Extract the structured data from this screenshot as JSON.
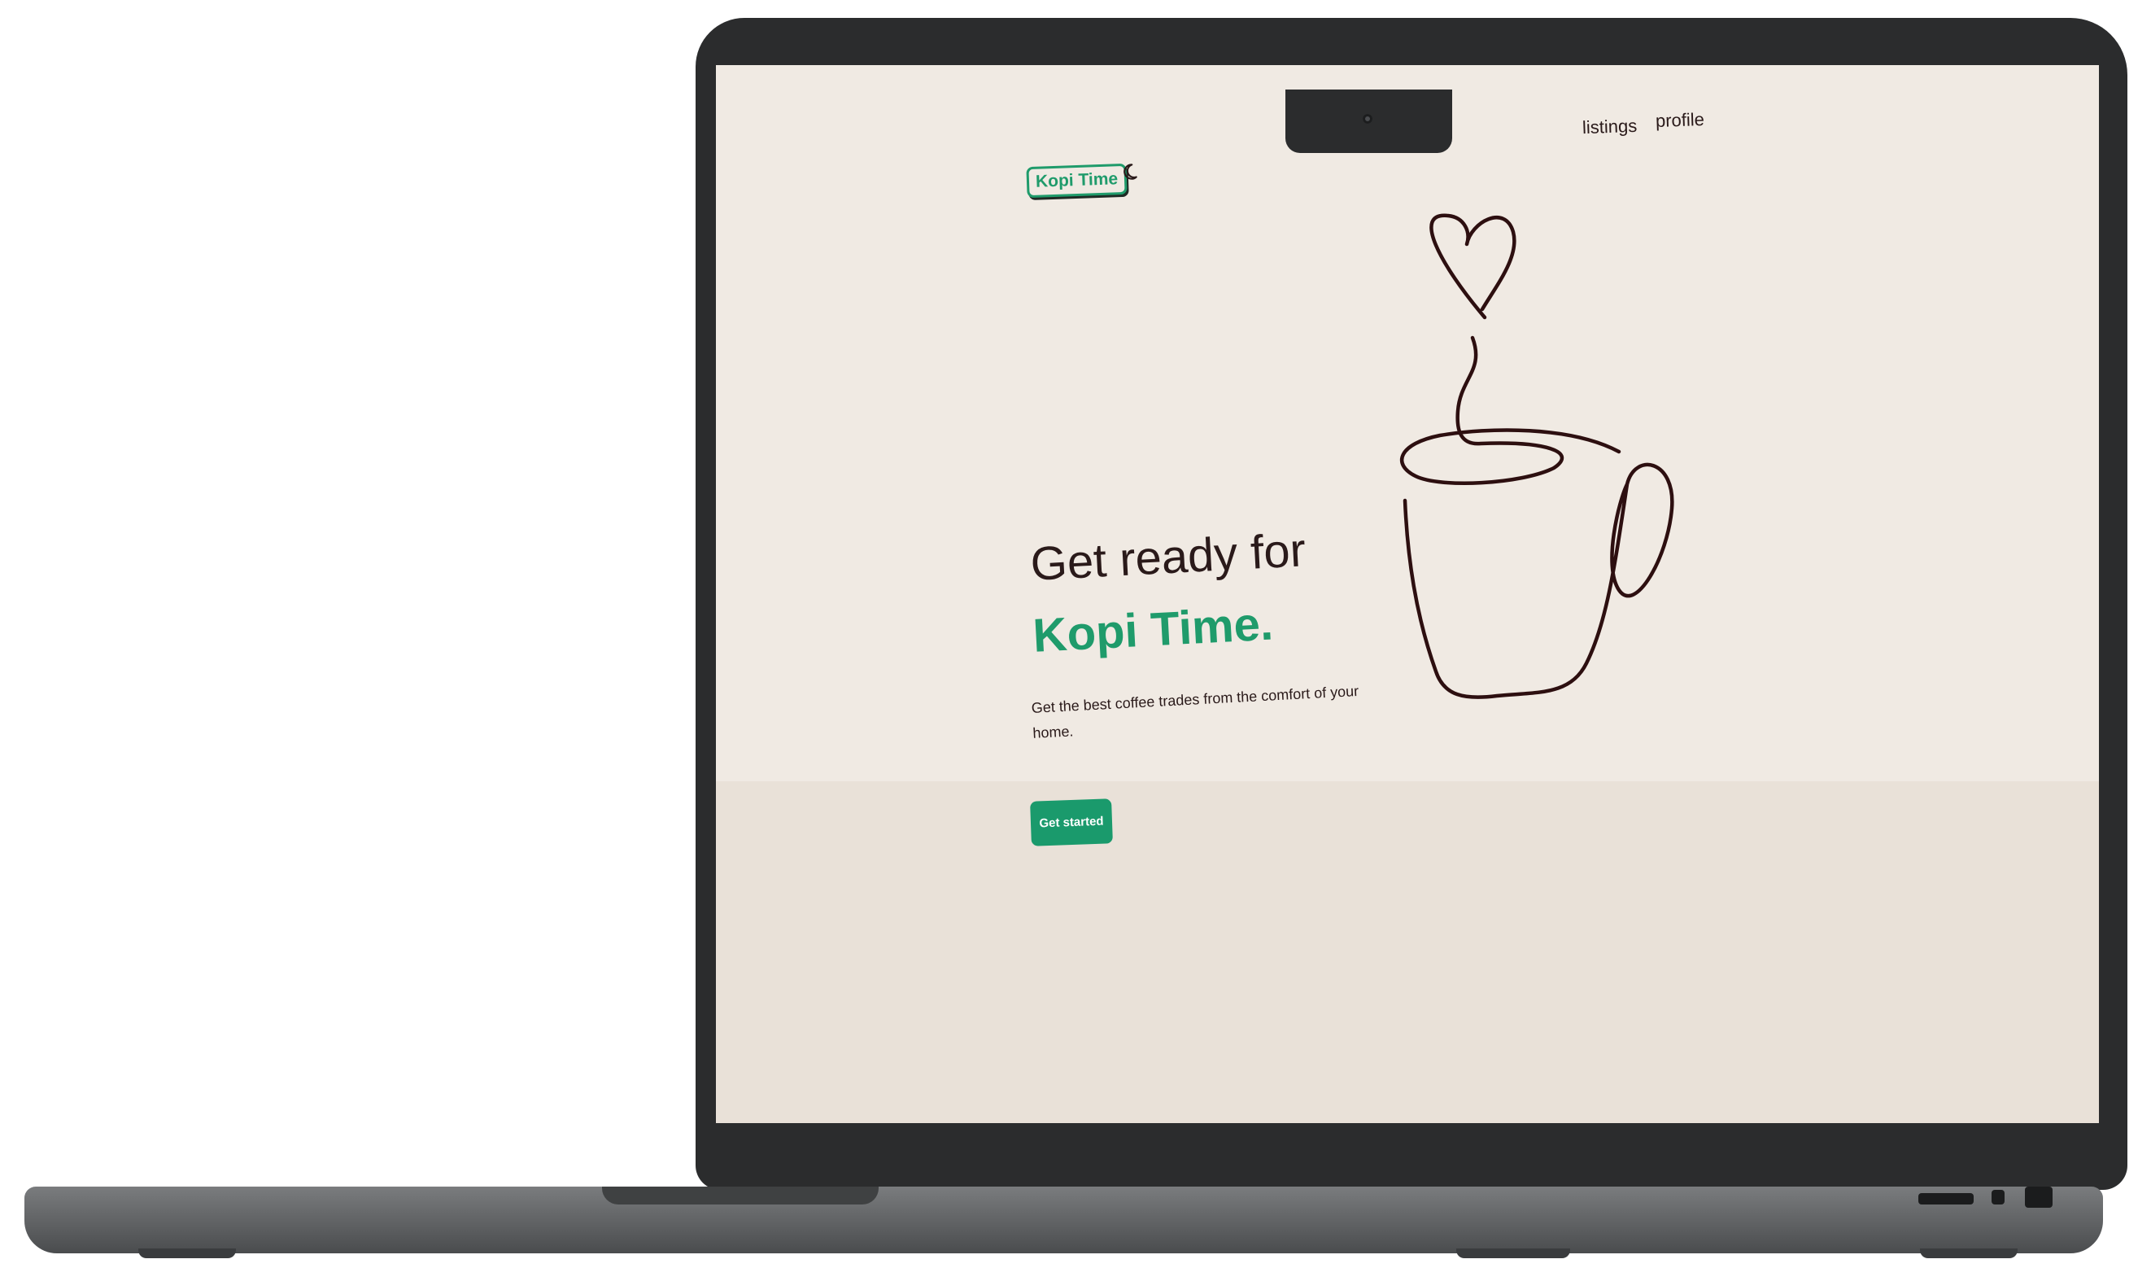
{
  "header": {
    "brand": "Kopi Time",
    "theme_toggle_icon": "moon-icon",
    "nav": [
      {
        "label": "listings"
      },
      {
        "label": "profile"
      }
    ]
  },
  "hero": {
    "title_line1": "Get ready for",
    "title_line2": "Kopi Time.",
    "subtitle": "Get the best coffee trades from the comfort of your home.",
    "cta_label": "Get started",
    "illustration_icon": "coffee-cup-heart-icon"
  },
  "colors": {
    "accent": "#1f9b6b",
    "background": "#f0eae3",
    "text": "#2a1a1a"
  }
}
